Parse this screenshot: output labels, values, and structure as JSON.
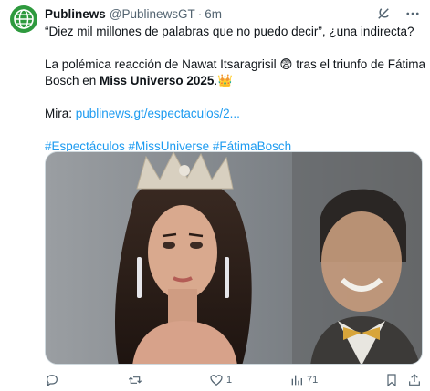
{
  "tweet": {
    "author_name": "Publinews",
    "author_handle": "@PublinewsGT",
    "separator": "·",
    "time": "6m",
    "line1": "“Diez mil millones de palabras que no puedo decir”, ¿una indirecta?",
    "line2": "La polémica reacción de Nawat Itsaragrisil 😨 tras el triunfo de Fátima",
    "line3_prefix": "Bosch en ",
    "line3_bold": "Miss Universo 2025",
    "line3_suffix": ".👑",
    "mira_label": "Mira: ",
    "link": "publinews.gt/espectaculos/2...",
    "hashtags": "#Espectáculos #MissUniverse #FátimaBosch"
  },
  "actions": {
    "reply_count": "",
    "retweet_count": "",
    "like_count": "1",
    "views_count": "71"
  },
  "icons": [
    "globe-icon",
    "grok-icon",
    "more-icon",
    "reply-icon",
    "retweet-icon",
    "like-icon",
    "views-icon",
    "bookmark-icon",
    "share-icon"
  ],
  "colors": {
    "link": "#1d9bf0",
    "muted": "#536471",
    "avatar_bg": "#2e9a3e"
  }
}
